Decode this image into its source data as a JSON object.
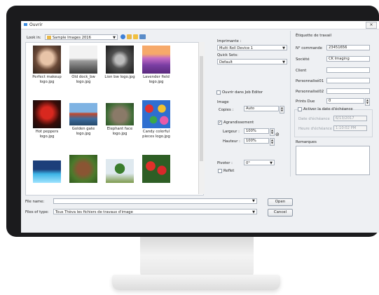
{
  "dialog": {
    "title": "Ouvrir",
    "close_label": "×",
    "look_in_label": "Look in:",
    "look_in_value": "Sample Images 2016",
    "file_name_label": "File name:",
    "file_name_value": "",
    "files_of_type_label": "Files of type:",
    "files_of_type_value": "Tous Thèva les fichiers de travaux d'image",
    "open_label": "Open",
    "cancel_label": "Cancel"
  },
  "files": [
    {
      "label": "Perfect makeup logo.jpg",
      "icon": "portrait-thumbnail"
    },
    {
      "label": "Old dock_bw logo.jpg",
      "icon": "dock-bw-thumbnail"
    },
    {
      "label": "Lion bw logo.jpg",
      "icon": "lion-bw-thumbnail"
    },
    {
      "label": "Lavender field logo.jpg",
      "icon": "lavender-field-thumbnail"
    },
    {
      "label": "Hot peppers logo.jpg",
      "icon": "peppers-thumbnail"
    },
    {
      "label": "Golden gate logo.jpg",
      "icon": "golden-gate-thumbnail"
    },
    {
      "label": "Elephant face logo.jpg",
      "icon": "elephant-thumbnail"
    },
    {
      "label": "Candy colorful pieces logo.jpg",
      "icon": "candy-thumbnail"
    },
    {
      "label": "",
      "icon": "pool-thumbnail"
    },
    {
      "label": "",
      "icon": "cow-thumbnail"
    },
    {
      "label": "",
      "icon": "tree-thumbnail"
    },
    {
      "label": "",
      "icon": "flowers-thumbnail"
    }
  ],
  "print": {
    "printer_label": "Imprimante :",
    "printer_value": "Multi Roll Device 1",
    "quickset_label": "Quick Sets:",
    "quickset_value": "Default",
    "open_job_editor_label": "Ouvrir dans Job Editor",
    "image_label": "Image",
    "copies_label": "Copies :",
    "copies_value": "Auto",
    "enlarge_label": "Agrandissement",
    "width_label": "Largeur :",
    "width_value": "100%",
    "height_label": "Hauteur :",
    "height_value": "100%",
    "rotate_label": "Pivoter :",
    "rotate_value": "0°",
    "mirror_label": "Reflet"
  },
  "job_label": {
    "title": "Étiquette de travail",
    "order_label": "N° commande",
    "order_value": "23451656",
    "company_label": "Société",
    "company_value": "CK Imaging",
    "client_label": "Client",
    "client_value": "",
    "custom1_label": "Personnalisé01",
    "custom1_value": "",
    "custom2_label": "Personnalisé02",
    "custom2_value": "",
    "prints_due_label": "Prints Due",
    "prints_due_value": "0",
    "activate_due_label": "Activer la date d'échéance",
    "due_date_label": "Date d'échéance",
    "due_date_value": "6/13/2017",
    "due_time_label": "Heure d'échéance",
    "due_time_value": "1:10:02 PM",
    "remarks_label": "Remarques"
  },
  "colors": {
    "bezel": "#1b1b1d",
    "dialog_bg": "#eef0f3",
    "accent": "#3c8ce0"
  }
}
